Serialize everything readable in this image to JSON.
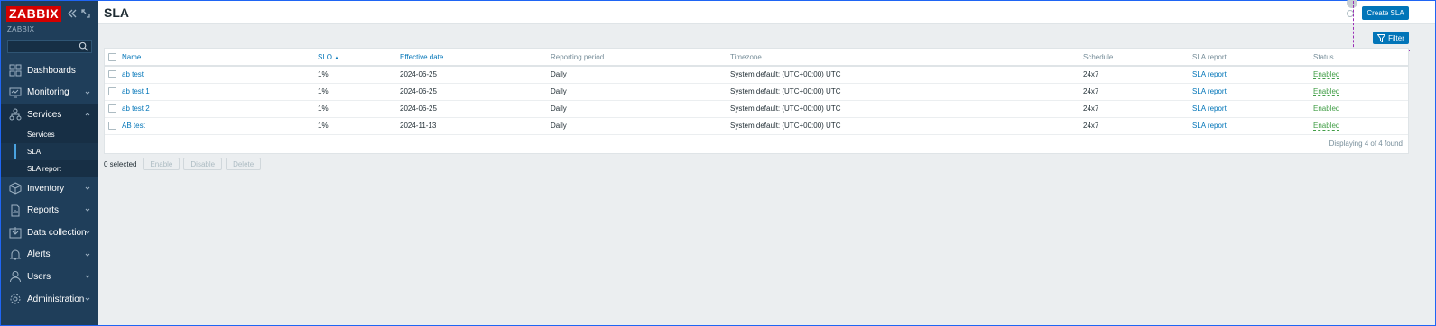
{
  "app": {
    "logo": "ZABBIX",
    "server_name": "ZABBIX"
  },
  "sidebar": {
    "search_value": "",
    "menu": [
      {
        "label": "Dashboards",
        "icon": "dashboards-icon"
      },
      {
        "label": "Monitoring",
        "icon": "monitoring-icon"
      },
      {
        "label": "Services",
        "icon": "services-icon",
        "open": true,
        "sub": [
          {
            "label": "Services"
          },
          {
            "label": "SLA",
            "active": true
          },
          {
            "label": "SLA report"
          }
        ]
      },
      {
        "label": "Inventory",
        "icon": "inventory-icon"
      },
      {
        "label": "Reports",
        "icon": "reports-icon"
      },
      {
        "label": "Data collection",
        "icon": "data-collection-icon"
      },
      {
        "label": "Alerts",
        "icon": "alerts-icon"
      },
      {
        "label": "Users",
        "icon": "users-icon"
      },
      {
        "label": "Administration",
        "icon": "administration-icon"
      }
    ]
  },
  "header": {
    "title": "SLA",
    "create_label": "Create SLA",
    "filter_label": "Filter"
  },
  "table": {
    "columns": [
      "Name",
      "SLO",
      "Effective date",
      "Reporting period",
      "Timezone",
      "Schedule",
      "SLA report",
      "Status"
    ],
    "rows": [
      {
        "name": "ab test",
        "slo": "1%",
        "effective_date": "2024-06-25",
        "period": "Daily",
        "timezone": "System default: (UTC+00:00) UTC",
        "schedule": "24x7",
        "report": "SLA report",
        "status": "Enabled"
      },
      {
        "name": "ab test 1",
        "slo": "1%",
        "effective_date": "2024-06-25",
        "period": "Daily",
        "timezone": "System default: (UTC+00:00) UTC",
        "schedule": "24x7",
        "report": "SLA report",
        "status": "Enabled"
      },
      {
        "name": "ab test 2",
        "slo": "1%",
        "effective_date": "2024-06-25",
        "period": "Daily",
        "timezone": "System default: (UTC+00:00) UTC",
        "schedule": "24x7",
        "report": "SLA report",
        "status": "Enabled"
      },
      {
        "name": "AB test",
        "slo": "1%",
        "effective_date": "2024-11-13",
        "period": "Daily",
        "timezone": "System default: (UTC+00:00) UTC",
        "schedule": "24x7",
        "report": "SLA report",
        "status": "Enabled"
      }
    ],
    "footer": "Displaying 4 of 4 found"
  },
  "actions": {
    "selected": "0 selected",
    "enable": "Enable",
    "disable": "Disable",
    "delete": "Delete"
  },
  "colors": {
    "sidebar": "#1f3e5a",
    "accent": "#0275b8",
    "enabled": "#429e47",
    "logo": "#d40000"
  }
}
